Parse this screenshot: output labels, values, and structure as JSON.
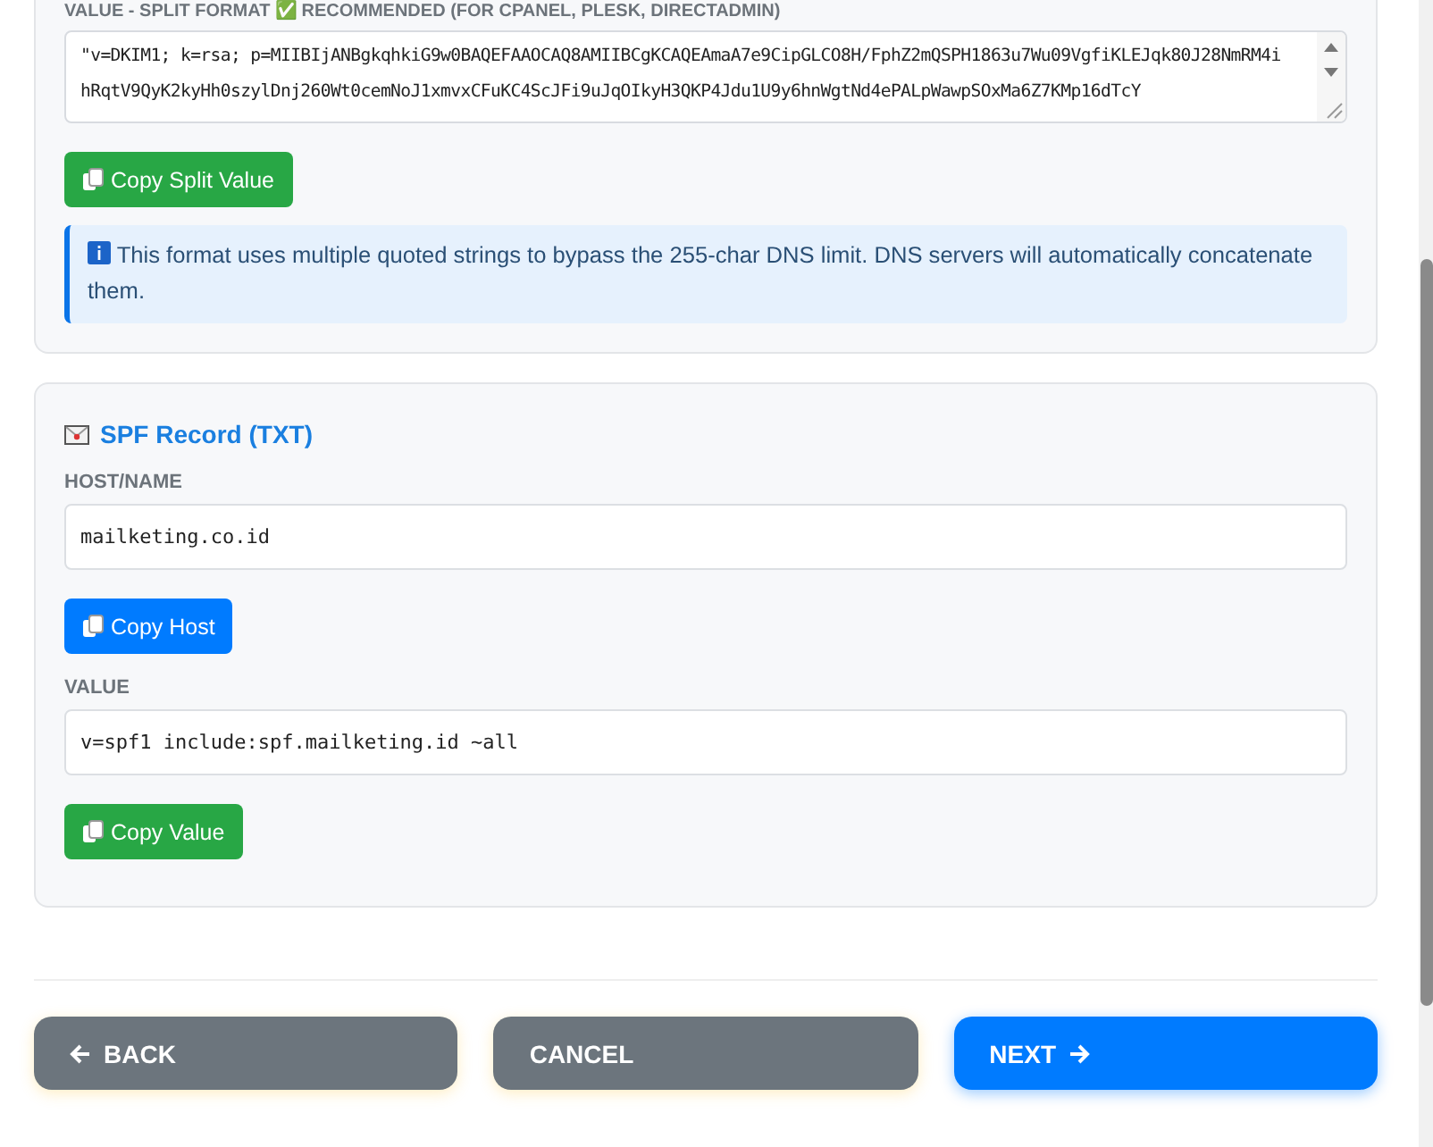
{
  "dkim_split": {
    "label": "VALUE - SPLIT FORMAT ✅ RECOMMENDED (FOR CPANEL, PLESK, DIRECTADMIN)",
    "value": "\"v=DKIM1; k=rsa; p=MIIBIjANBgkqhkiG9w0BAQEFAAOCAQ8AMIIBCgKCAQEAmaA7e9CipGLCO8H/FphZ2mQSPH1863u7Wu09VgfiKLEJqk80J28NmRM4ihRqtV9QyK2kyHh0szylDnj260Wt0cemNoJ1xmvxCFuKC4ScJFi9uJqOIkyH3QKP4Jdu1U9y6hnWgtNd4ePALpWawpSOxMa6Z7KMp16dTcY",
    "button": "Copy Split Value",
    "info": "This format uses multiple quoted strings to bypass the 255-char DNS limit. DNS servers will automatically concatenate them."
  },
  "spf": {
    "title": "SPF Record (TXT)",
    "host_label": "HOST/NAME",
    "host": "mailketing.co.id",
    "host_button": "Copy Host",
    "value_label": "VALUE",
    "value": "v=spf1 include:spf.mailketing.id ~all",
    "value_button": "Copy Value"
  },
  "footer": {
    "buttons": [
      {
        "label": "BACK",
        "kind": "back"
      },
      {
        "label": "CANCEL",
        "kind": "cancel"
      },
      {
        "label": "NEXT",
        "kind": "next"
      }
    ]
  }
}
